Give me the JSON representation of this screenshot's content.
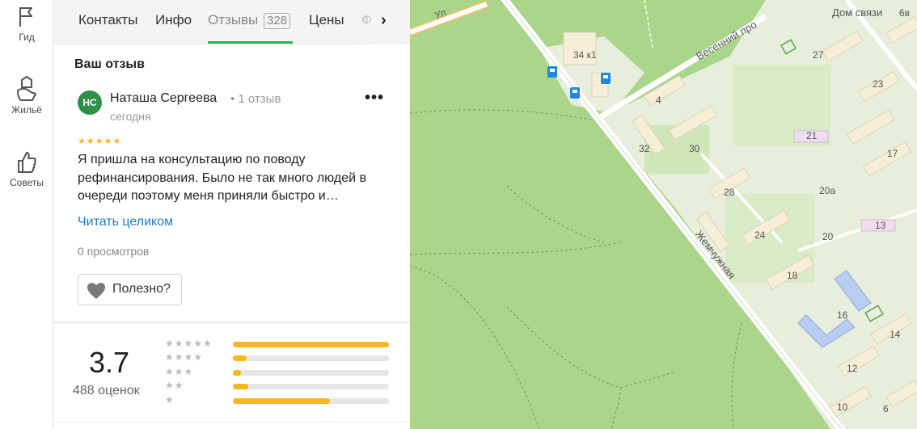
{
  "rail": {
    "items": [
      {
        "label": "Гид",
        "icon": "flag-icon"
      },
      {
        "label": "Жильё",
        "icon": "house-hand-icon"
      },
      {
        "label": "Советы",
        "icon": "thumbs-up-icon"
      }
    ]
  },
  "tabs": {
    "items": [
      {
        "label": "Контакты"
      },
      {
        "label": "Инфо"
      },
      {
        "label": "Отзывы",
        "count": "328",
        "active": true
      },
      {
        "label": "Цены"
      },
      {
        "label": "Ф"
      }
    ],
    "arrow": "›"
  },
  "review": {
    "section_title": "Ваш отзыв",
    "avatar_initials": "НС",
    "author": "Наташа Сергеева",
    "author_meta": "• 1 отзыв",
    "date": "сегодня",
    "more": "•••",
    "stars": "★★★★★",
    "rating_stars": 5,
    "text": "Я пришла на консультацию по поводу рефинансирования. Было не так много людей в очереди поэтому меня приняли быстро и…",
    "read_more": "Читать целиком",
    "views": "0 просмотров",
    "useful_label": "Полезно?"
  },
  "rating": {
    "value": "3.7",
    "count": "488 оценок",
    "distribution": [
      {
        "stars": "★★★★★",
        "fraction": 1.0
      },
      {
        "stars": "★★★★",
        "fraction": 0.09
      },
      {
        "stars": "★★★",
        "fraction": 0.05
      },
      {
        "stars": "★★",
        "fraction": 0.1
      },
      {
        "stars": "★",
        "fraction": 0.62
      }
    ]
  },
  "map": {
    "street_labels": [
      "Жемчужная",
      "Весенний про",
      "Ул"
    ],
    "poi_label": "Дом связи",
    "building_numbers": [
      "34 к1",
      "27",
      "23",
      "4",
      "21",
      "32",
      "30",
      "17",
      "28",
      "20а",
      "13",
      "24",
      "20",
      "18",
      "16",
      "14",
      "12",
      "10",
      "6",
      "6в"
    ],
    "colors": {
      "forest": "#a9d48a",
      "residential": "#e9eedd",
      "building": "#f7efd8",
      "road": "#ffffff",
      "transit": "#1e88e5"
    }
  },
  "colors": {
    "accent_green": "#2db14f",
    "star_yellow": "#f7b71d",
    "link_blue": "#1e7ac7",
    "avatar_green": "#2f8f46"
  }
}
